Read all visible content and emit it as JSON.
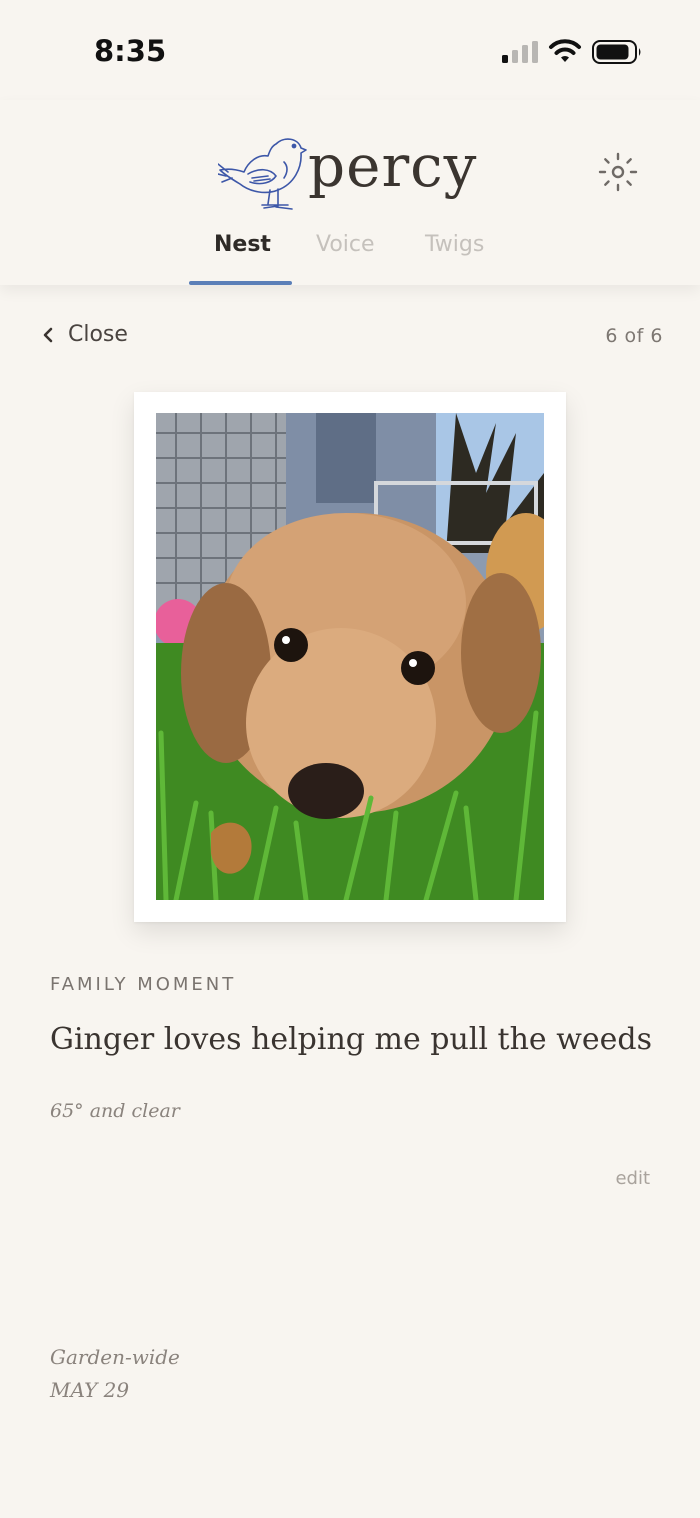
{
  "status_bar": {
    "time": "8:35"
  },
  "header": {
    "logo_text": "percy",
    "tabs": [
      {
        "label": "Nest",
        "active": true
      },
      {
        "label": "Voice",
        "active": false
      },
      {
        "label": "Twigs",
        "active": false
      }
    ],
    "accent_color": "#5b7fb8"
  },
  "viewer": {
    "close_label": "Close",
    "counter": "6 of 6"
  },
  "moment": {
    "category": "FAMILY MOMENT",
    "title": "Ginger loves helping me pull the weeds",
    "weather": "65° and clear",
    "edit_label": "edit",
    "location": "Garden-wide",
    "date": "MAY 29"
  },
  "icons": {
    "bird": "bird-logo-icon",
    "settings": "sun-settings-icon",
    "back": "chevron-left-icon"
  }
}
